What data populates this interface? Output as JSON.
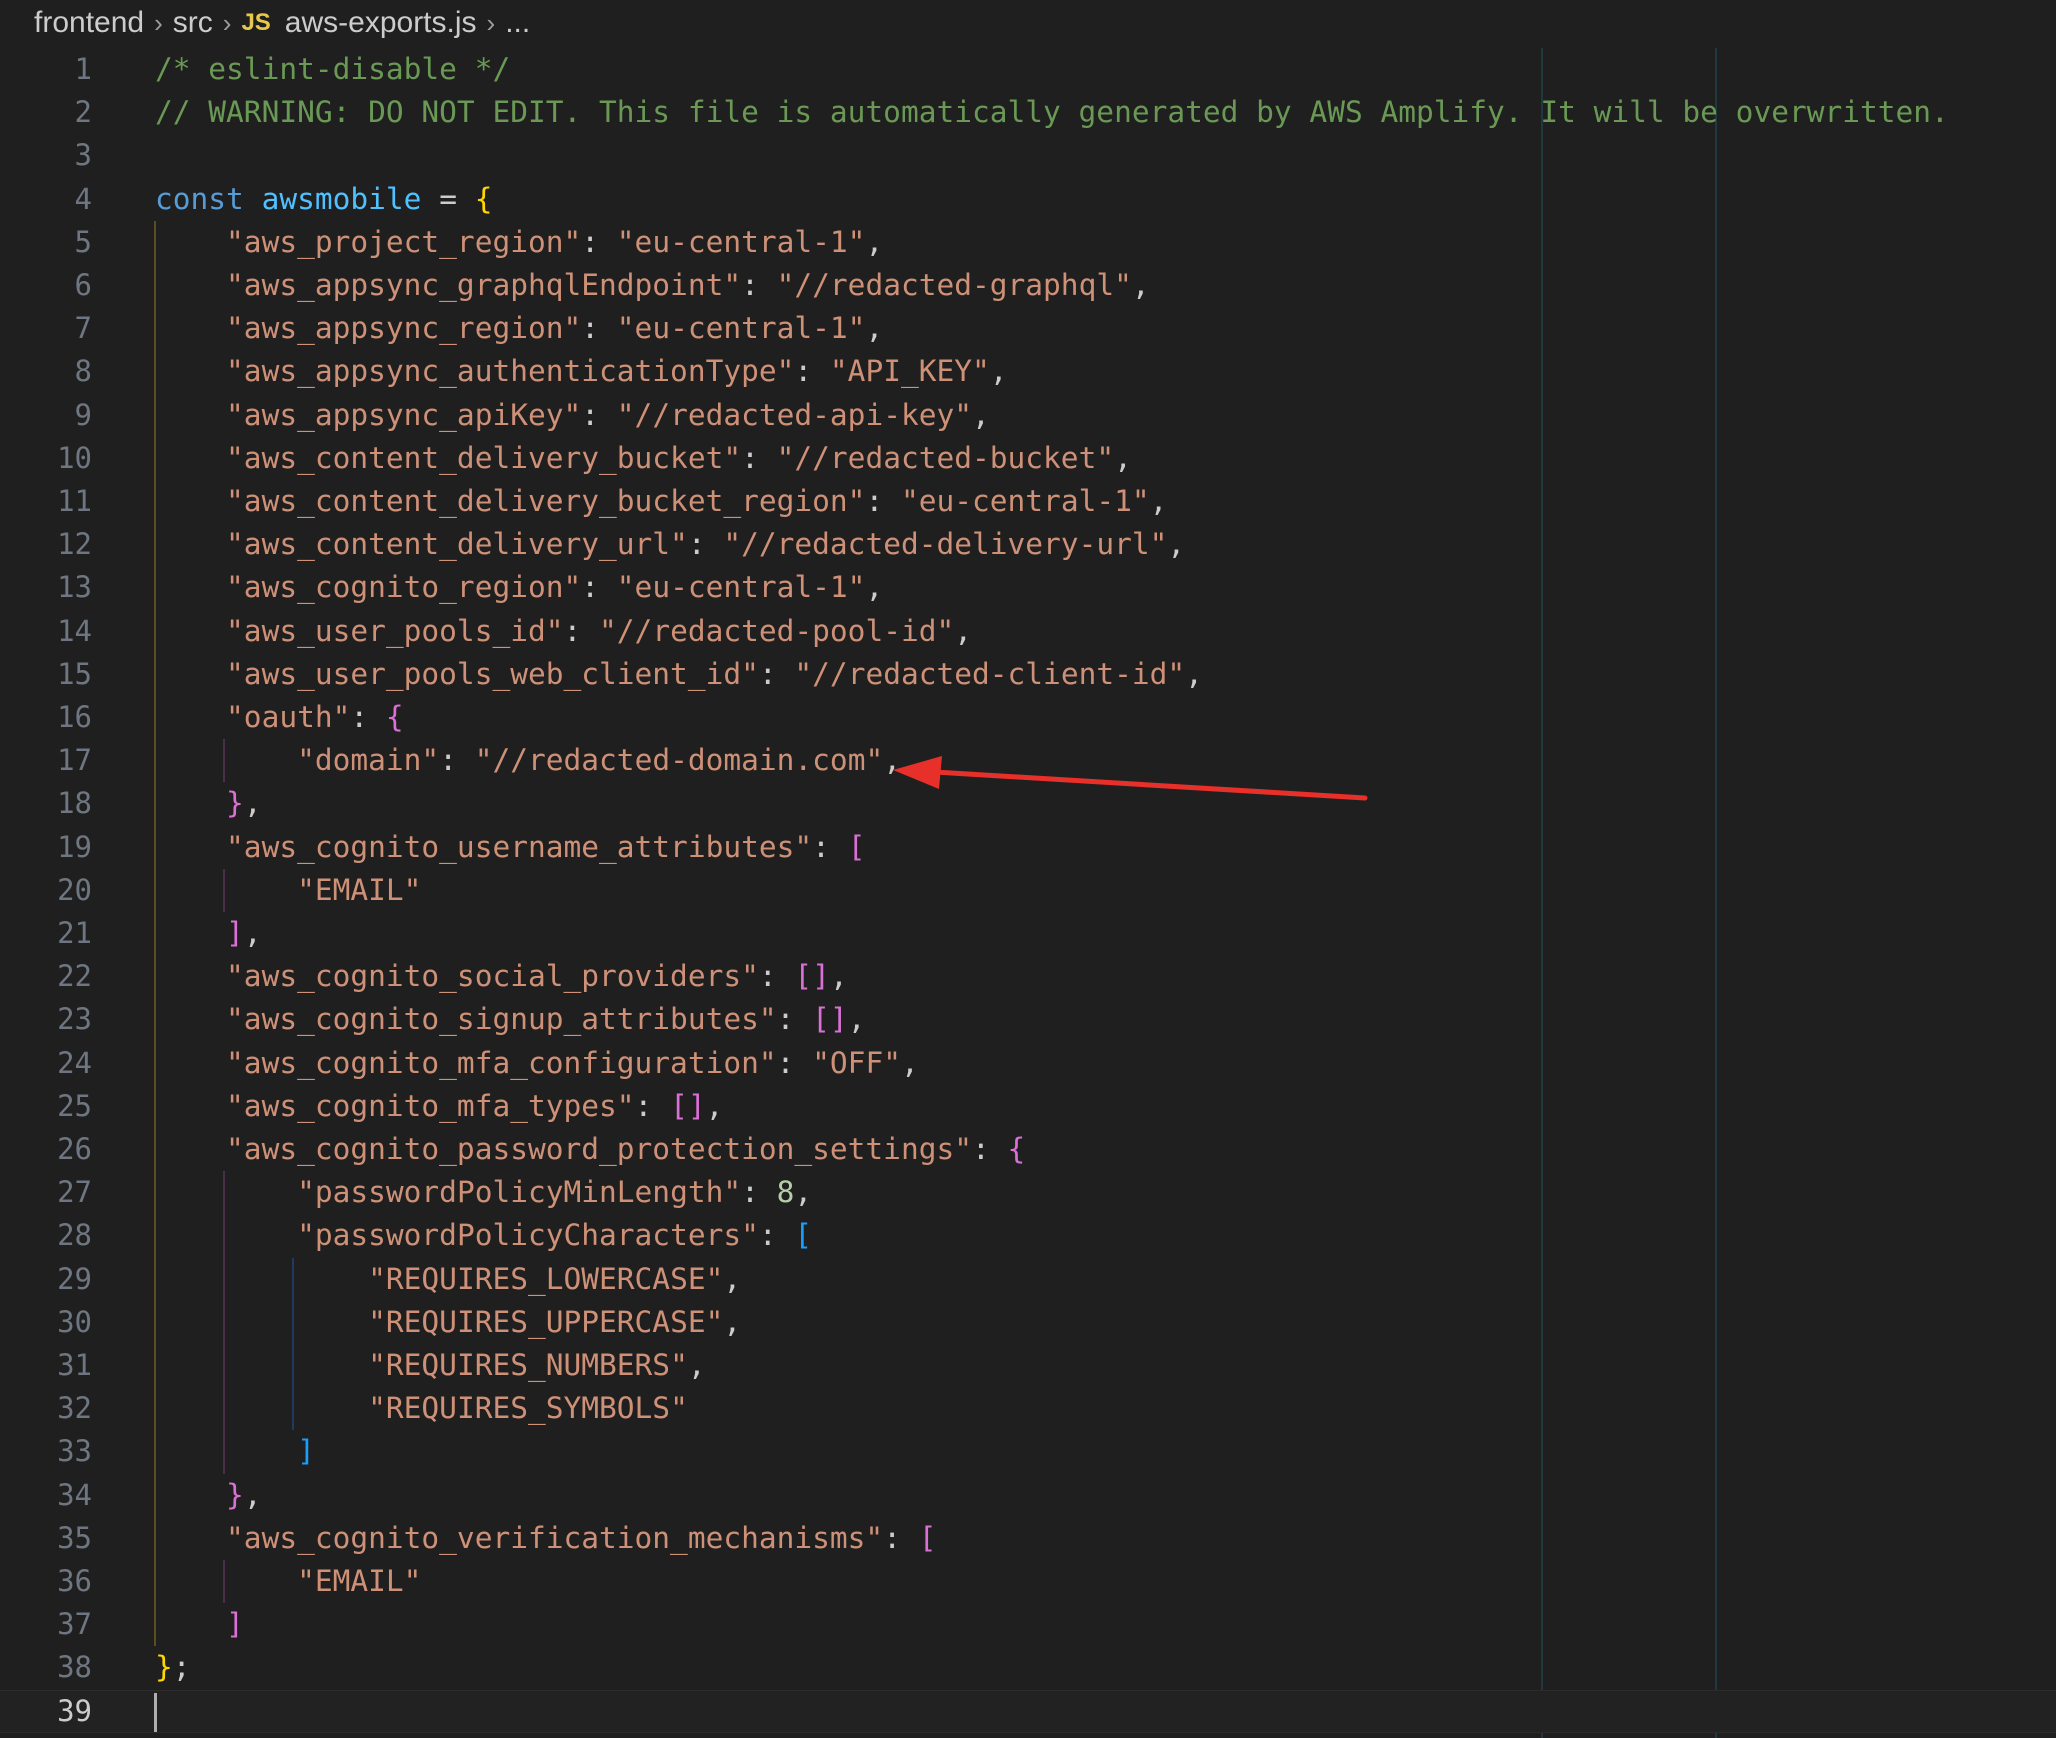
{
  "breadcrumb": {
    "parts": [
      "frontend",
      "src"
    ],
    "file_icon": "JS",
    "file": "aws-exports.js",
    "ellipsis": "..."
  },
  "editor": {
    "active_line": 39,
    "lines": [
      {
        "n": "1",
        "t": [
          {
            "c": "comment",
            "s": "/* eslint-disable */"
          }
        ]
      },
      {
        "n": "2",
        "t": [
          {
            "c": "comment",
            "s": "// WARNING: DO NOT EDIT. This file is automatically generated by AWS Amplify. It will be overwritten."
          }
        ]
      },
      {
        "n": "3",
        "t": []
      },
      {
        "n": "4",
        "t": [
          {
            "c": "kw",
            "s": "const"
          },
          {
            "c": "p",
            "s": " "
          },
          {
            "c": "var",
            "s": "awsmobile"
          },
          {
            "c": "p",
            "s": " = "
          },
          {
            "c": "b1",
            "s": "{"
          }
        ]
      },
      {
        "n": "5",
        "t": [
          {
            "c": "p",
            "s": "    "
          },
          {
            "c": "str",
            "s": "\"aws_project_region\""
          },
          {
            "c": "p",
            "s": ": "
          },
          {
            "c": "str",
            "s": "\"eu-central-1\""
          },
          {
            "c": "p",
            "s": ","
          }
        ]
      },
      {
        "n": "6",
        "t": [
          {
            "c": "p",
            "s": "    "
          },
          {
            "c": "str",
            "s": "\"aws_appsync_graphqlEndpoint\""
          },
          {
            "c": "p",
            "s": ": "
          },
          {
            "c": "str",
            "s": "\"//redacted-graphql\""
          },
          {
            "c": "p",
            "s": ","
          }
        ]
      },
      {
        "n": "7",
        "t": [
          {
            "c": "p",
            "s": "    "
          },
          {
            "c": "str",
            "s": "\"aws_appsync_region\""
          },
          {
            "c": "p",
            "s": ": "
          },
          {
            "c": "str",
            "s": "\"eu-central-1\""
          },
          {
            "c": "p",
            "s": ","
          }
        ]
      },
      {
        "n": "8",
        "t": [
          {
            "c": "p",
            "s": "    "
          },
          {
            "c": "str",
            "s": "\"aws_appsync_authenticationType\""
          },
          {
            "c": "p",
            "s": ": "
          },
          {
            "c": "str",
            "s": "\"API_KEY\""
          },
          {
            "c": "p",
            "s": ","
          }
        ]
      },
      {
        "n": "9",
        "t": [
          {
            "c": "p",
            "s": "    "
          },
          {
            "c": "str",
            "s": "\"aws_appsync_apiKey\""
          },
          {
            "c": "p",
            "s": ": "
          },
          {
            "c": "str",
            "s": "\"//redacted-api-key\""
          },
          {
            "c": "p",
            "s": ","
          }
        ]
      },
      {
        "n": "10",
        "t": [
          {
            "c": "p",
            "s": "    "
          },
          {
            "c": "str",
            "s": "\"aws_content_delivery_bucket\""
          },
          {
            "c": "p",
            "s": ": "
          },
          {
            "c": "str",
            "s": "\"//redacted-bucket\""
          },
          {
            "c": "p",
            "s": ","
          }
        ]
      },
      {
        "n": "11",
        "t": [
          {
            "c": "p",
            "s": "    "
          },
          {
            "c": "str",
            "s": "\"aws_content_delivery_bucket_region\""
          },
          {
            "c": "p",
            "s": ": "
          },
          {
            "c": "str",
            "s": "\"eu-central-1\""
          },
          {
            "c": "p",
            "s": ","
          }
        ]
      },
      {
        "n": "12",
        "t": [
          {
            "c": "p",
            "s": "    "
          },
          {
            "c": "str",
            "s": "\"aws_content_delivery_url\""
          },
          {
            "c": "p",
            "s": ": "
          },
          {
            "c": "str",
            "s": "\"//redacted-delivery-url\""
          },
          {
            "c": "p",
            "s": ","
          }
        ]
      },
      {
        "n": "13",
        "t": [
          {
            "c": "p",
            "s": "    "
          },
          {
            "c": "str",
            "s": "\"aws_cognito_region\""
          },
          {
            "c": "p",
            "s": ": "
          },
          {
            "c": "str",
            "s": "\"eu-central-1\""
          },
          {
            "c": "p",
            "s": ","
          }
        ]
      },
      {
        "n": "14",
        "t": [
          {
            "c": "p",
            "s": "    "
          },
          {
            "c": "str",
            "s": "\"aws_user_pools_id\""
          },
          {
            "c": "p",
            "s": ": "
          },
          {
            "c": "str",
            "s": "\"//redacted-pool-id\""
          },
          {
            "c": "p",
            "s": ","
          }
        ]
      },
      {
        "n": "15",
        "t": [
          {
            "c": "p",
            "s": "    "
          },
          {
            "c": "str",
            "s": "\"aws_user_pools_web_client_id\""
          },
          {
            "c": "p",
            "s": ": "
          },
          {
            "c": "str",
            "s": "\"//redacted-client-id\""
          },
          {
            "c": "p",
            "s": ","
          }
        ]
      },
      {
        "n": "16",
        "t": [
          {
            "c": "p",
            "s": "    "
          },
          {
            "c": "str",
            "s": "\"oauth\""
          },
          {
            "c": "p",
            "s": ": "
          },
          {
            "c": "b2",
            "s": "{"
          }
        ]
      },
      {
        "n": "17",
        "t": [
          {
            "c": "p",
            "s": "        "
          },
          {
            "c": "str",
            "s": "\"domain\""
          },
          {
            "c": "p",
            "s": ": "
          },
          {
            "c": "str",
            "s": "\"//redacted-domain.com\""
          },
          {
            "c": "p",
            "s": ","
          }
        ]
      },
      {
        "n": "18",
        "t": [
          {
            "c": "p",
            "s": "    "
          },
          {
            "c": "b2",
            "s": "}"
          },
          {
            "c": "p",
            "s": ","
          }
        ]
      },
      {
        "n": "19",
        "t": [
          {
            "c": "p",
            "s": "    "
          },
          {
            "c": "str",
            "s": "\"aws_cognito_username_attributes\""
          },
          {
            "c": "p",
            "s": ": "
          },
          {
            "c": "b2",
            "s": "["
          }
        ]
      },
      {
        "n": "20",
        "t": [
          {
            "c": "p",
            "s": "        "
          },
          {
            "c": "str",
            "s": "\"EMAIL\""
          }
        ]
      },
      {
        "n": "21",
        "t": [
          {
            "c": "p",
            "s": "    "
          },
          {
            "c": "b2",
            "s": "]"
          },
          {
            "c": "p",
            "s": ","
          }
        ]
      },
      {
        "n": "22",
        "t": [
          {
            "c": "p",
            "s": "    "
          },
          {
            "c": "str",
            "s": "\"aws_cognito_social_providers\""
          },
          {
            "c": "p",
            "s": ": "
          },
          {
            "c": "b2",
            "s": "[]"
          },
          {
            "c": "p",
            "s": ","
          }
        ]
      },
      {
        "n": "23",
        "t": [
          {
            "c": "p",
            "s": "    "
          },
          {
            "c": "str",
            "s": "\"aws_cognito_signup_attributes\""
          },
          {
            "c": "p",
            "s": ": "
          },
          {
            "c": "b2",
            "s": "[]"
          },
          {
            "c": "p",
            "s": ","
          }
        ]
      },
      {
        "n": "24",
        "t": [
          {
            "c": "p",
            "s": "    "
          },
          {
            "c": "str",
            "s": "\"aws_cognito_mfa_configuration\""
          },
          {
            "c": "p",
            "s": ": "
          },
          {
            "c": "str",
            "s": "\"OFF\""
          },
          {
            "c": "p",
            "s": ","
          }
        ]
      },
      {
        "n": "25",
        "t": [
          {
            "c": "p",
            "s": "    "
          },
          {
            "c": "str",
            "s": "\"aws_cognito_mfa_types\""
          },
          {
            "c": "p",
            "s": ": "
          },
          {
            "c": "b2",
            "s": "[]"
          },
          {
            "c": "p",
            "s": ","
          }
        ]
      },
      {
        "n": "26",
        "t": [
          {
            "c": "p",
            "s": "    "
          },
          {
            "c": "str",
            "s": "\"aws_cognito_password_protection_settings\""
          },
          {
            "c": "p",
            "s": ": "
          },
          {
            "c": "b2",
            "s": "{"
          }
        ]
      },
      {
        "n": "27",
        "t": [
          {
            "c": "p",
            "s": "        "
          },
          {
            "c": "str",
            "s": "\"passwordPolicyMinLength\""
          },
          {
            "c": "p",
            "s": ": "
          },
          {
            "c": "num",
            "s": "8"
          },
          {
            "c": "p",
            "s": ","
          }
        ]
      },
      {
        "n": "28",
        "t": [
          {
            "c": "p",
            "s": "        "
          },
          {
            "c": "str",
            "s": "\"passwordPolicyCharacters\""
          },
          {
            "c": "p",
            "s": ": "
          },
          {
            "c": "b3",
            "s": "["
          }
        ]
      },
      {
        "n": "29",
        "t": [
          {
            "c": "p",
            "s": "            "
          },
          {
            "c": "str",
            "s": "\"REQUIRES_LOWERCASE\""
          },
          {
            "c": "p",
            "s": ","
          }
        ]
      },
      {
        "n": "30",
        "t": [
          {
            "c": "p",
            "s": "            "
          },
          {
            "c": "str",
            "s": "\"REQUIRES_UPPERCASE\""
          },
          {
            "c": "p",
            "s": ","
          }
        ]
      },
      {
        "n": "31",
        "t": [
          {
            "c": "p",
            "s": "            "
          },
          {
            "c": "str",
            "s": "\"REQUIRES_NUMBERS\""
          },
          {
            "c": "p",
            "s": ","
          }
        ]
      },
      {
        "n": "32",
        "t": [
          {
            "c": "p",
            "s": "            "
          },
          {
            "c": "str",
            "s": "\"REQUIRES_SYMBOLS\""
          }
        ]
      },
      {
        "n": "33",
        "t": [
          {
            "c": "p",
            "s": "        "
          },
          {
            "c": "b3",
            "s": "]"
          }
        ]
      },
      {
        "n": "34",
        "t": [
          {
            "c": "p",
            "s": "    "
          },
          {
            "c": "b2",
            "s": "}"
          },
          {
            "c": "p",
            "s": ","
          }
        ]
      },
      {
        "n": "35",
        "t": [
          {
            "c": "p",
            "s": "    "
          },
          {
            "c": "str",
            "s": "\"aws_cognito_verification_mechanisms\""
          },
          {
            "c": "p",
            "s": ": "
          },
          {
            "c": "b2",
            "s": "["
          }
        ]
      },
      {
        "n": "36",
        "t": [
          {
            "c": "p",
            "s": "        "
          },
          {
            "c": "str",
            "s": "\"EMAIL\""
          }
        ]
      },
      {
        "n": "37",
        "t": [
          {
            "c": "p",
            "s": "    "
          },
          {
            "c": "b2",
            "s": "]"
          }
        ]
      },
      {
        "n": "38",
        "t": [
          {
            "c": "b1",
            "s": "}"
          },
          {
            "c": "p",
            "s": ";"
          }
        ]
      },
      {
        "n": "39",
        "t": []
      }
    ]
  },
  "colors": {
    "guide_level1": "#5a4e1e",
    "guide_level2": "#4a2f4a",
    "guide_level3": "#1f3a5c",
    "annotation_arrow": "#e8302a"
  }
}
